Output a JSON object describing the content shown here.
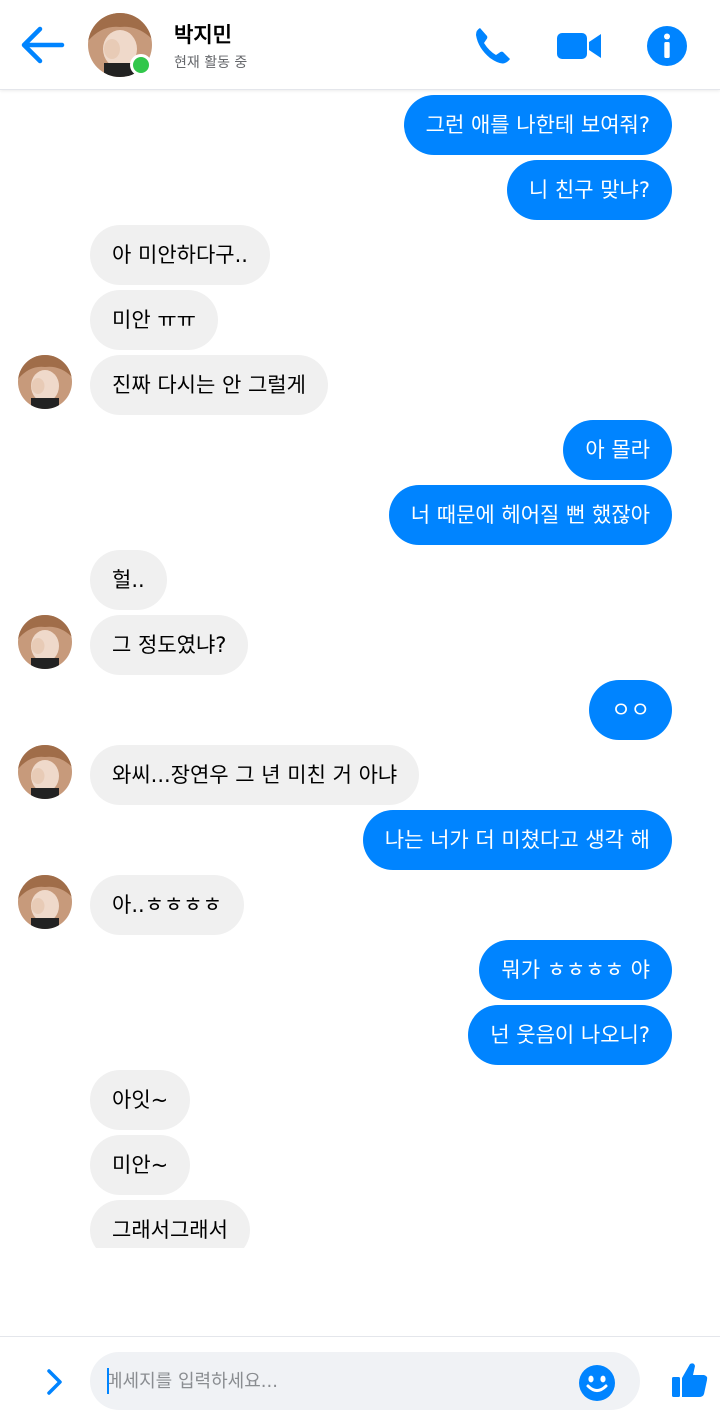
{
  "header": {
    "contact_name": "박지민",
    "status": "현재 활동 중",
    "back_icon": "arrow-left-icon",
    "phone_icon": "phone-icon",
    "video_icon": "video-camera-icon",
    "info_icon": "info-icon"
  },
  "messages": [
    {
      "side": "out",
      "text": "그런 애를 나한테 보여줘?"
    },
    {
      "side": "out",
      "text": "니 친구 맞냐?"
    },
    {
      "side": "in",
      "text": "아 미안하다구.."
    },
    {
      "side": "in",
      "text": "미안 ㅠㅠ"
    },
    {
      "side": "in",
      "text": "진짜 다시는 안 그럴게",
      "avatar": true
    },
    {
      "side": "out",
      "text": "아 몰라"
    },
    {
      "side": "out",
      "text": "너 때문에 헤어질 뻔 했잖아"
    },
    {
      "side": "in",
      "text": "헐.."
    },
    {
      "side": "in",
      "text": "그 정도였냐?",
      "avatar": true
    },
    {
      "side": "out",
      "text": "ㅇㅇ"
    },
    {
      "side": "in",
      "text": "와씨...장연우 그 년 미친 거 아냐",
      "avatar": true
    },
    {
      "side": "out",
      "text": "나는 너가 더 미쳤다고 생각 해"
    },
    {
      "side": "in",
      "text": "아..ㅎㅎㅎㅎ",
      "avatar": true
    },
    {
      "side": "out",
      "text": "뭐가 ㅎㅎㅎㅎ 야"
    },
    {
      "side": "out",
      "text": "넌 웃음이 나오니?"
    },
    {
      "side": "in",
      "text": "아잇~"
    },
    {
      "side": "in",
      "text": "미안~"
    },
    {
      "side": "in",
      "text": "그래서그래서"
    }
  ],
  "composer": {
    "placeholder": "메세지를 입력하세요...",
    "value": "",
    "expand_icon": "chevron-right-icon",
    "emoji_icon": "smiley-icon",
    "like_icon": "thumbs-up-icon"
  },
  "colors": {
    "accent": "#0084ff",
    "incoming_bubble": "#f0f0f0",
    "online": "#31c74b"
  }
}
